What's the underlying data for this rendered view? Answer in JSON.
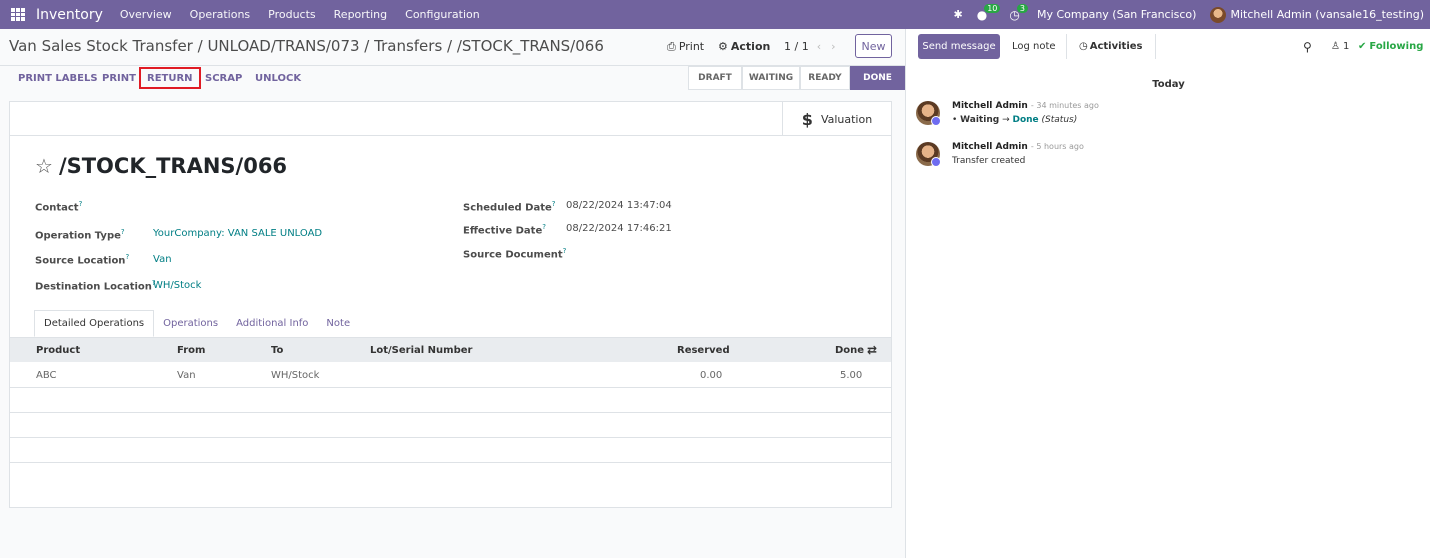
{
  "topbar": {
    "app": "Inventory",
    "menus": [
      "Overview",
      "Operations",
      "Products",
      "Reporting",
      "Configuration"
    ],
    "msg_count": "10",
    "activity_count": "3",
    "company": "My Company (San Francisco)",
    "user": "Mitchell Admin (vansale16_testing)"
  },
  "breadcrumb": "Van Sales Stock Transfer / UNLOAD/TRANS/073 / Transfers / /STOCK_TRANS/066",
  "controls": {
    "print": "Print",
    "action": "Action",
    "pager": "1 / 1",
    "new": "New"
  },
  "actions": {
    "print_labels": "PRINT LABELS",
    "print": "PRINT",
    "return": "RETURN",
    "scrap": "SCRAP",
    "unlock": "UNLOCK"
  },
  "statusbar": [
    "DRAFT",
    "WAITING",
    "READY",
    "DONE"
  ],
  "valuation": "Valuation",
  "record": {
    "title": "/STOCK_TRANS/066",
    "labels": {
      "contact": "Contact",
      "operation_type": "Operation Type",
      "source_location": "Source Location",
      "destination_location": "Destination Location",
      "scheduled_date": "Scheduled Date",
      "effective_date": "Effective Date",
      "source_document": "Source Document"
    },
    "values": {
      "operation_type": "YourCompany: VAN SALE UNLOAD",
      "source_location": "Van",
      "destination_location": "WH/Stock",
      "scheduled_date": "08/22/2024 13:47:04",
      "effective_date": "08/22/2024 17:46:21"
    }
  },
  "tabs": [
    "Detailed Operations",
    "Operations",
    "Additional Info",
    "Note"
  ],
  "table": {
    "columns": [
      "Product",
      "From",
      "To",
      "Lot/Serial Number",
      "Reserved",
      "Done"
    ],
    "rows": [
      {
        "product": "ABC",
        "from": "Van",
        "to": "WH/Stock",
        "lot": "",
        "reserved": "0.00",
        "done": "5.00"
      }
    ]
  },
  "chatter": {
    "send": "Send message",
    "log": "Log note",
    "activities": "Activities",
    "followers": "1",
    "following": "Following",
    "today": "Today",
    "messages": [
      {
        "author": "Mitchell Admin",
        "time": "- 34 minutes ago",
        "from": "Waiting",
        "to": "Done",
        "field": "(Status)"
      },
      {
        "author": "Mitchell Admin",
        "time": "- 5 hours ago",
        "body": "Transfer created"
      }
    ]
  }
}
